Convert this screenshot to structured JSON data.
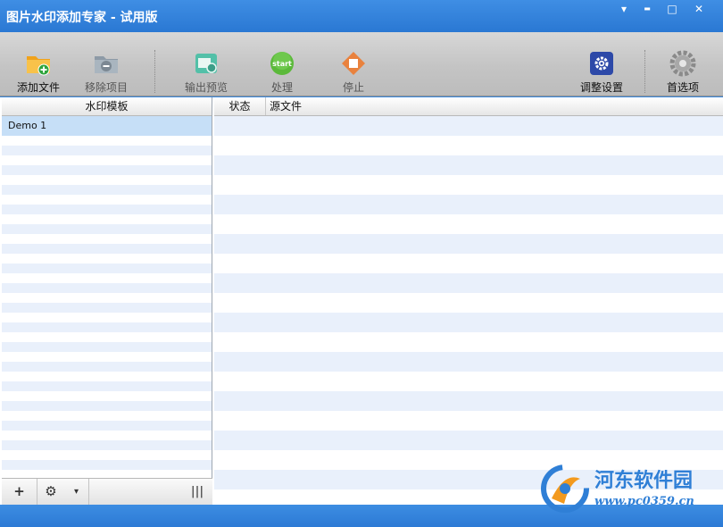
{
  "window": {
    "title": "图片水印添加专家 - 试用版",
    "controls": {
      "menu": "▾",
      "minimize": "▬",
      "maximize": "□",
      "close": "✕"
    }
  },
  "toolbar": {
    "add_file": "添加文件",
    "remove_item": "移除项目",
    "output_preview": "输出预览",
    "process": "处理",
    "stop": "停止",
    "adjust_settings": "调整设置",
    "preferences": "首选项",
    "start_icon_text": "start"
  },
  "left_panel": {
    "header": "水印模板",
    "items": [
      {
        "label": "Demo 1",
        "selected": true
      }
    ],
    "bottom": {
      "add": "+",
      "settings": "⚙",
      "dropdown": "▾",
      "columns": "|||"
    }
  },
  "right_panel": {
    "columns": [
      "状态",
      "源文件"
    ]
  },
  "watermark": {
    "name": "河东软件园",
    "url": "www.pc0359.cn"
  },
  "colors": {
    "titlebar": "#2a78d3",
    "selection": "#c6dff7",
    "row_stripe": "#e9f0fb",
    "statusbar": "#2c7ad5"
  }
}
